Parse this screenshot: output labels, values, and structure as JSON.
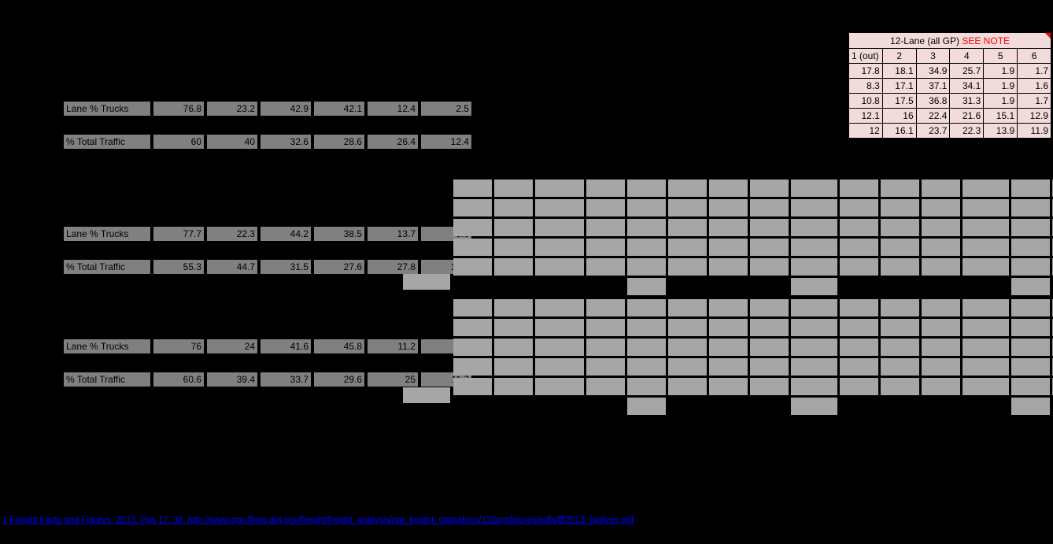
{
  "reference_table": {
    "title": "12-Lane (all GP)",
    "note_label": "SEE NOTE",
    "headers": [
      "1 (out)",
      "2",
      "3",
      "4",
      "5",
      "6"
    ],
    "rows": [
      [
        "17.8",
        "18.1",
        "34.9",
        "25.7",
        "1.9",
        "1.7"
      ],
      [
        "8.3",
        "17.1",
        "37.1",
        "34.1",
        "1.9",
        "1.6"
      ],
      [
        "10.8",
        "17.5",
        "36.8",
        "31.3",
        "1.9",
        "1.7"
      ],
      [
        "12.1",
        "16",
        "22.4",
        "21.6",
        "15.1",
        "12.9"
      ],
      [
        "12",
        "16.1",
        "23.7",
        "22.3",
        "13.9",
        "11.9"
      ]
    ],
    "colors": {
      "fill": "#f2dcdb",
      "note": "#ff0000",
      "border": "#000000"
    }
  },
  "blocks": [
    {
      "id": "block-1",
      "lane_trucks": {
        "label": "Lane % Trucks",
        "values": [
          "76.8",
          "23.2",
          "42.9",
          "42.1",
          "12.4",
          "2.5"
        ]
      },
      "total_traffic": {
        "label": "% Total Traffic",
        "values": [
          "60",
          "40",
          "32.6",
          "28.6",
          "26.4",
          "12.4"
        ]
      }
    },
    {
      "id": "block-2",
      "lane_trucks": {
        "label": "Lane % Trucks",
        "values": [
          "77.7",
          "22.3",
          "44.2",
          "38.5",
          "13.7",
          "3.6"
        ]
      },
      "total_traffic": {
        "label": "% Total Traffic",
        "values": [
          "55.3",
          "44.7",
          "31.5",
          "27.6",
          "27.8",
          "13.1"
        ]
      }
    },
    {
      "id": "block-3",
      "lane_trucks": {
        "label": "Lane % Trucks",
        "values": [
          "76",
          "24",
          "41.6",
          "45.8",
          "11.2",
          "1.4"
        ]
      },
      "total_traffic": {
        "label": "% Total Traffic",
        "values": [
          "60.6",
          "39.4",
          "33.7",
          "29.6",
          "25",
          "11.7"
        ]
      }
    }
  ],
  "grid": {
    "columns": 18,
    "rows": 5,
    "cell_color": "#a6a6a6",
    "partial_row_filled_columns": [
      4,
      8,
      13,
      16,
      17
    ]
  },
  "footnote": {
    "text": "1 Freight Facts and Figures, 2013.  Pgs 17, 38. http://www.ops.fhwa.dot.gov/freight/freight_analysis/nat_freight_stats/docs/13factsfigures/pdfs/fff2013_highres.pdf",
    "color": "#0000ff"
  }
}
